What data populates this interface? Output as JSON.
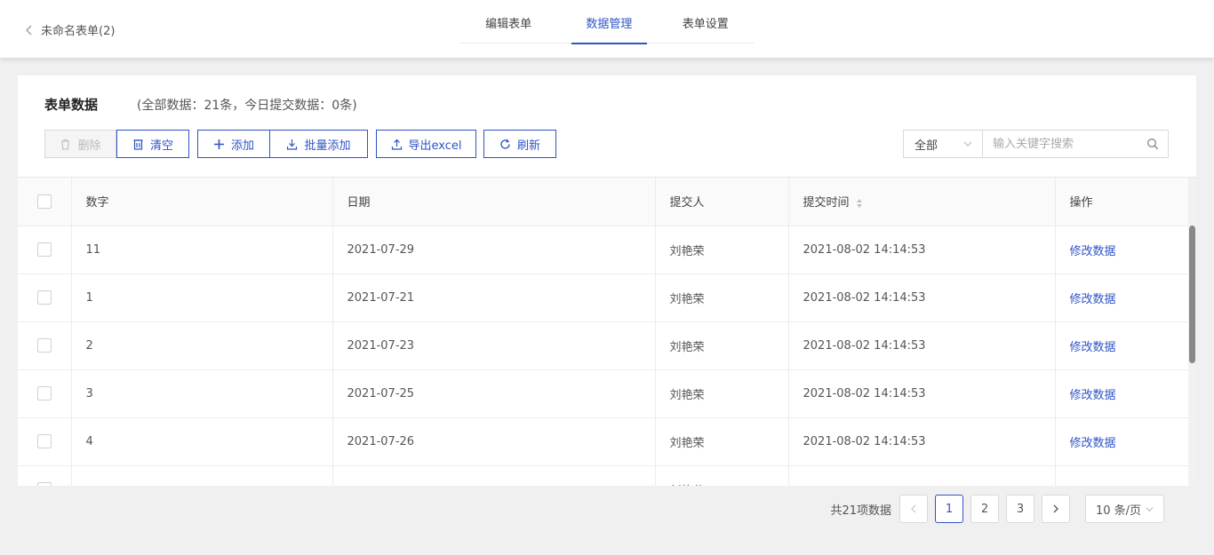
{
  "header": {
    "back_label": "未命名表单(2)",
    "tabs": [
      {
        "label": "编辑表单",
        "active": false
      },
      {
        "label": "数据管理",
        "active": true
      },
      {
        "label": "表单设置",
        "active": false
      }
    ]
  },
  "panel": {
    "title": "表单数据",
    "summary": "(全部数据：21条，今日提交数据：0条)"
  },
  "toolbar": {
    "delete_label": "删除",
    "clear_label": "清空",
    "add_label": "添加",
    "batch_add_label": "批量添加",
    "export_label": "导出excel",
    "refresh_label": "刷新"
  },
  "filter": {
    "scope_value": "全部",
    "search_placeholder": "输入关键字搜索"
  },
  "table": {
    "columns": [
      "数字",
      "日期",
      "提交人",
      "提交时间",
      "操作"
    ],
    "rows": [
      {
        "number": "11",
        "date": "2021-07-29",
        "submitter": "刘艳荣",
        "time": "2021-08-02 14:14:53",
        "action": "修改数据"
      },
      {
        "number": "1",
        "date": "2021-07-21",
        "submitter": "刘艳荣",
        "time": "2021-08-02 14:14:53",
        "action": "修改数据"
      },
      {
        "number": "2",
        "date": "2021-07-23",
        "submitter": "刘艳荣",
        "time": "2021-08-02 14:14:53",
        "action": "修改数据"
      },
      {
        "number": "3",
        "date": "2021-07-25",
        "submitter": "刘艳荣",
        "time": "2021-08-02 14:14:53",
        "action": "修改数据"
      },
      {
        "number": "4",
        "date": "2021-07-26",
        "submitter": "刘艳荣",
        "time": "2021-08-02 14:14:53",
        "action": "修改数据"
      },
      {
        "number": "",
        "date": "",
        "submitter": "刘艳荣",
        "time": "",
        "action": ""
      }
    ]
  },
  "pagination": {
    "total_label": "共21项数据",
    "pages": [
      "1",
      "2",
      "3"
    ],
    "current_page": "1",
    "page_size": "10 条/页"
  },
  "colors": {
    "accent": "#2e54c6",
    "border": "#d9d9d9",
    "background": "#f0f0f0"
  }
}
